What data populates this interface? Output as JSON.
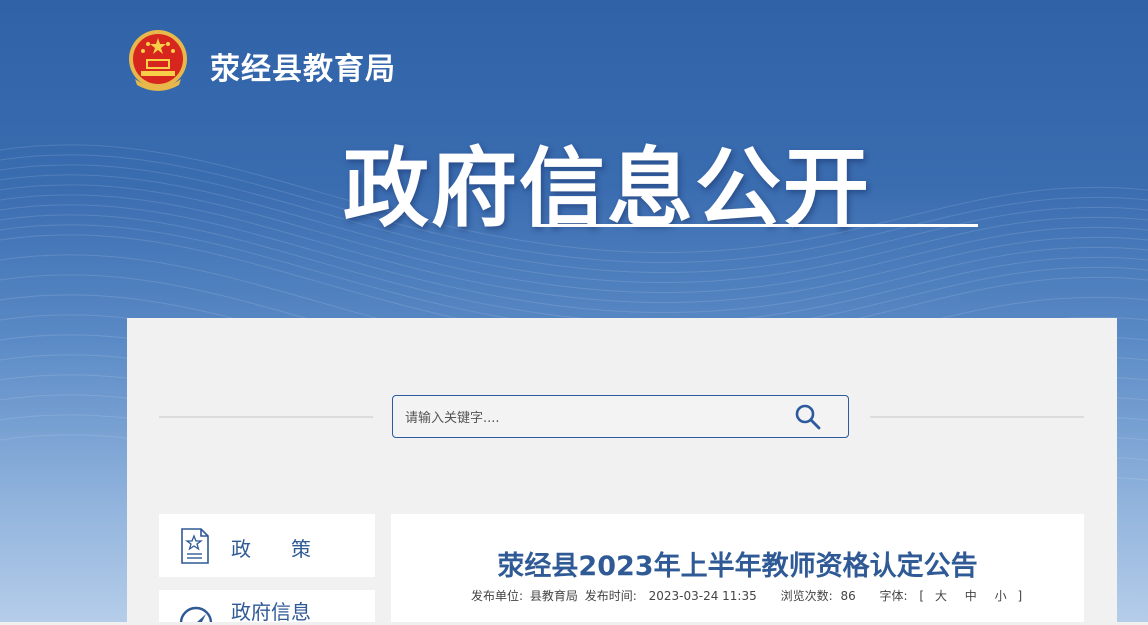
{
  "header": {
    "agency_name": "荥经县教育局",
    "section_title": "政府信息公开"
  },
  "search": {
    "placeholder": "请输入关键字....",
    "icon": "search-icon"
  },
  "sidebar": {
    "items": [
      {
        "label": "政　　策",
        "icon": "document-star-icon"
      },
      {
        "label": "政府信息",
        "icon": "compass-icon"
      }
    ]
  },
  "article": {
    "title": "荥经县2023年上半年教师资格认定公告",
    "publisher_label": "发布单位:",
    "publisher": "县教育局",
    "time_label": "发布时间:",
    "time": "2023-03-24 11:35",
    "views_label": "浏览次数:",
    "views": "86",
    "font_label": "字体:",
    "bracket_open": "[",
    "font_large": "大",
    "font_medium": "中",
    "font_small": "小",
    "bracket_close": "]"
  },
  "colors": {
    "brand_blue": "#2f5a96",
    "banner_top": "#3062a8",
    "panel_bg": "#f1f1f1"
  }
}
